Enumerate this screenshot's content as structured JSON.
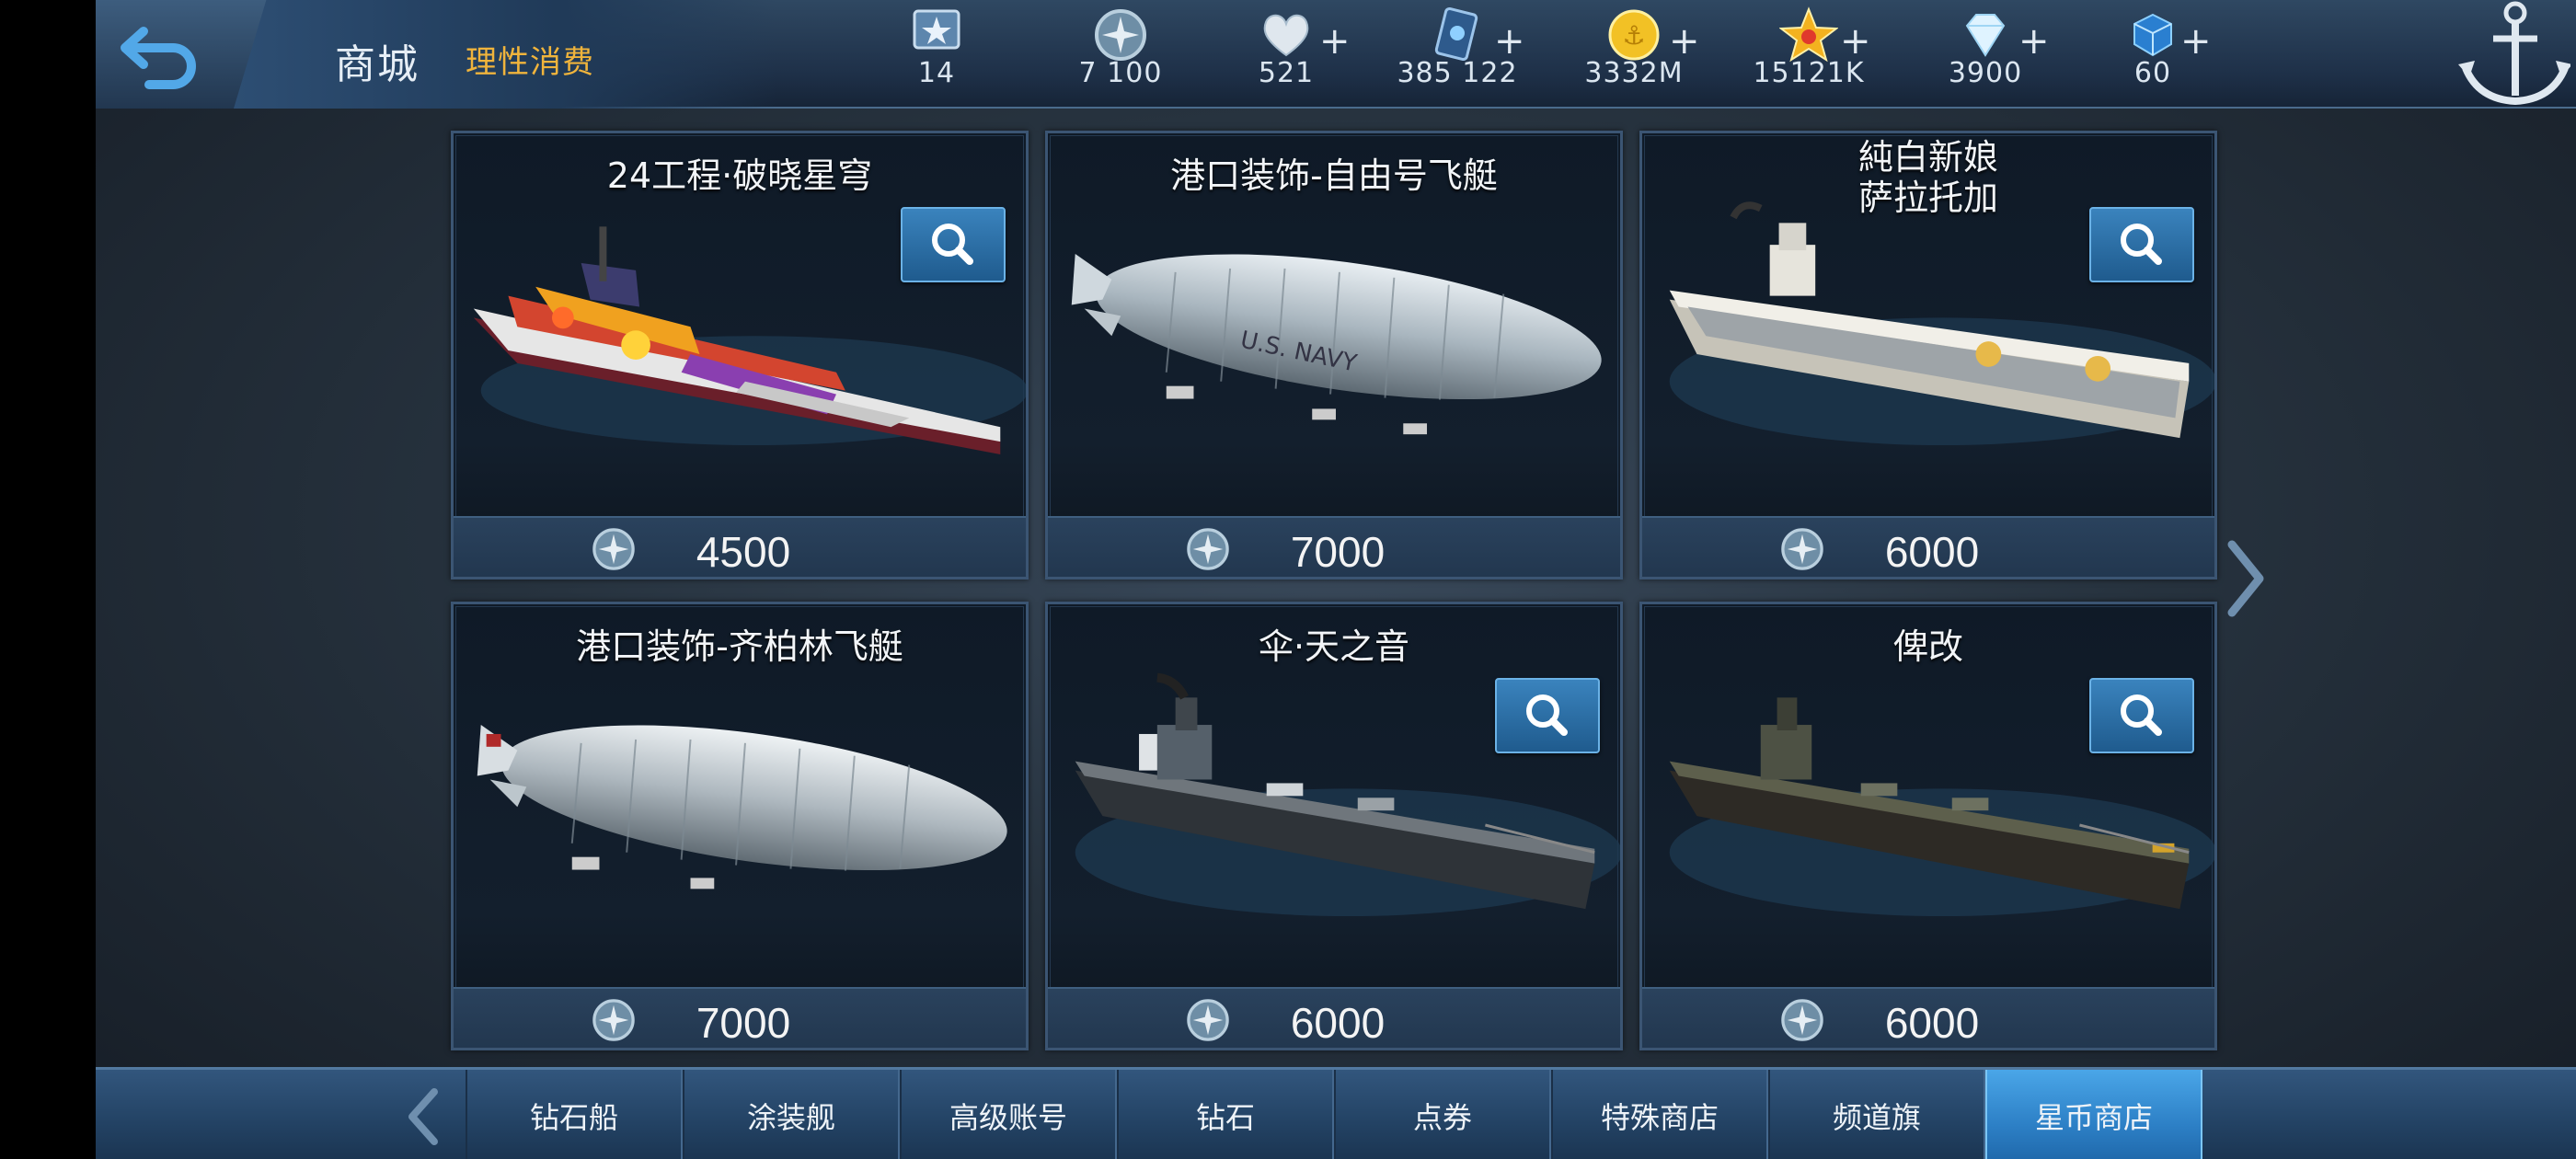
{
  "header": {
    "title": "商城",
    "subtitle": "理性消费"
  },
  "resources": [
    {
      "icon": "rank-badge-icon",
      "value": "14",
      "has_plus": false
    },
    {
      "icon": "star-coin-icon",
      "value": "7 100",
      "has_plus": false
    },
    {
      "icon": "heart-icon",
      "value": "521",
      "has_plus": true
    },
    {
      "icon": "card-icon",
      "value": "385 122",
      "has_plus": true
    },
    {
      "icon": "gold-coin-icon",
      "value": "3332M",
      "has_plus": true
    },
    {
      "icon": "gold-star-icon",
      "value": "15121K",
      "has_plus": true
    },
    {
      "icon": "diamond-icon",
      "value": "3900",
      "has_plus": true
    },
    {
      "icon": "blue-cube-icon",
      "value": "60",
      "has_plus": true
    }
  ],
  "items": [
    {
      "name": "24工程·破晓星穹",
      "price": "4500",
      "art": "ship-colorful",
      "has_zoom": true
    },
    {
      "name": "港口装饰-自由号飞艇",
      "price": "7000",
      "art": "airship-navy",
      "has_zoom": false
    },
    {
      "name": "純白新娘\n萨拉托加",
      "price": "6000",
      "art": "carrier-white",
      "has_zoom": true
    },
    {
      "name": "港口装饰-齐柏林飞艇",
      "price": "7000",
      "art": "airship-zeppelin",
      "has_zoom": false
    },
    {
      "name": "伞·天之音",
      "price": "6000",
      "art": "battleship-camo",
      "has_zoom": true
    },
    {
      "name": "俾改",
      "price": "6000",
      "art": "battleship-green",
      "has_zoom": true
    }
  ],
  "tabs": [
    {
      "label": "钻石船",
      "active": false
    },
    {
      "label": "涂装舰",
      "active": false
    },
    {
      "label": "高级账号",
      "active": false
    },
    {
      "label": "钻石",
      "active": false
    },
    {
      "label": "点券",
      "active": false
    },
    {
      "label": "特殊商店",
      "active": false
    },
    {
      "label": "频道旗",
      "active": false
    },
    {
      "label": "星币商店",
      "active": true
    }
  ],
  "colors": {
    "accent_orange": "#f0b43c",
    "active_tab": "#3a93d8",
    "panel_border": "#3b5573"
  }
}
